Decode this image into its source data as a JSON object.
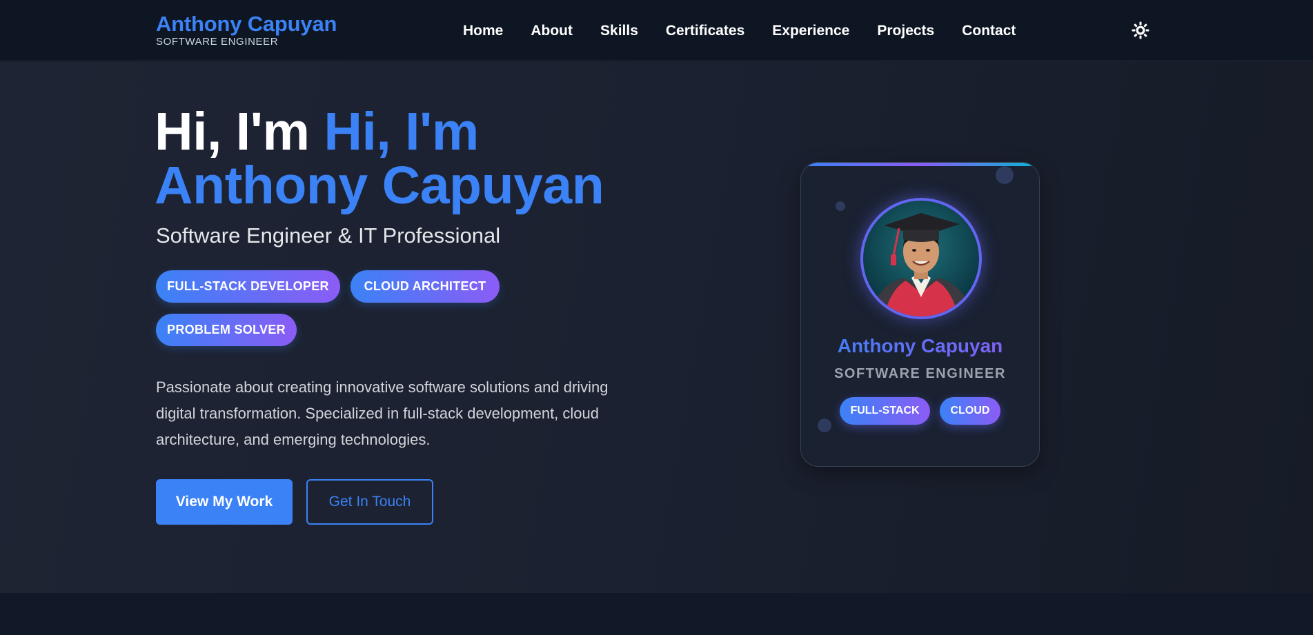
{
  "header": {
    "brand_name": "Anthony Capuyan",
    "brand_subtitle": "SOFTWARE ENGINEER",
    "nav": [
      "Home",
      "About",
      "Skills",
      "Certificates",
      "Experience",
      "Projects",
      "Contact"
    ],
    "theme_toggle_icon": "sun-icon"
  },
  "hero": {
    "title_prefix": "Hi, I'm",
    "title_highlight_1": "Hi, I'm",
    "title_highlight_2": "Anthony Capuyan",
    "subtitle": "Software Engineer & IT Professional",
    "role_tags": [
      "FULL-STACK DEVELOPER",
      "CLOUD ARCHITECT",
      "PROBLEM SOLVER"
    ],
    "description": "Passionate about creating innovative software solutions and driving digital transformation. Specialized in full-stack development, cloud architecture, and emerging technologies.",
    "primary_button": "View My Work",
    "secondary_button": "Get In Touch"
  },
  "profile_card": {
    "name": "Anthony Capuyan",
    "role": "SOFTWARE ENGINEER",
    "tags": [
      "FULL-STACK",
      "CLOUD"
    ],
    "avatar_alt": "graduation-portrait"
  },
  "colors": {
    "accent_blue": "#3b82f6",
    "accent_purple": "#8b5cf6",
    "accent_cyan": "#06b6d4",
    "background": "#111827"
  }
}
